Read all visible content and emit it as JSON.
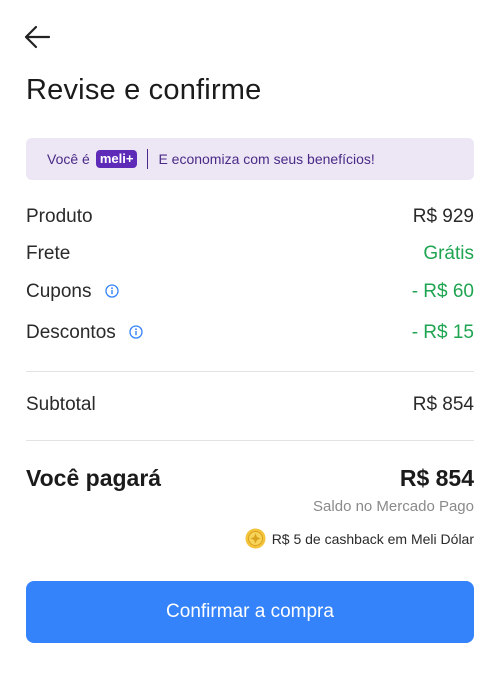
{
  "header": {
    "title": "Revise e confirme"
  },
  "banner": {
    "prefix": "Você é",
    "badge": "meli+",
    "text": "E economiza com seus benefícios!"
  },
  "summary": {
    "rows": [
      {
        "label": "Produto",
        "value": "R$ 929"
      },
      {
        "label": "Frete",
        "value": "Grátis"
      },
      {
        "label": "Cupons",
        "value": "- R$ 60"
      },
      {
        "label": "Descontos",
        "value": "- R$ 15"
      }
    ],
    "subtotal": {
      "label": "Subtotal",
      "value": "R$ 854"
    }
  },
  "total": {
    "label": "Você pagará",
    "value": "R$ 854",
    "payment_method": "Saldo no Mercado Pago",
    "cashback": "R$ 5 de cashback em Meli Dólar"
  },
  "actions": {
    "confirm_label": "Confirmar a compra"
  },
  "colors": {
    "accent": "#3483fa",
    "green": "#1fa552",
    "purple": "#5e2bb8",
    "banner_bg": "#ece6f5"
  }
}
